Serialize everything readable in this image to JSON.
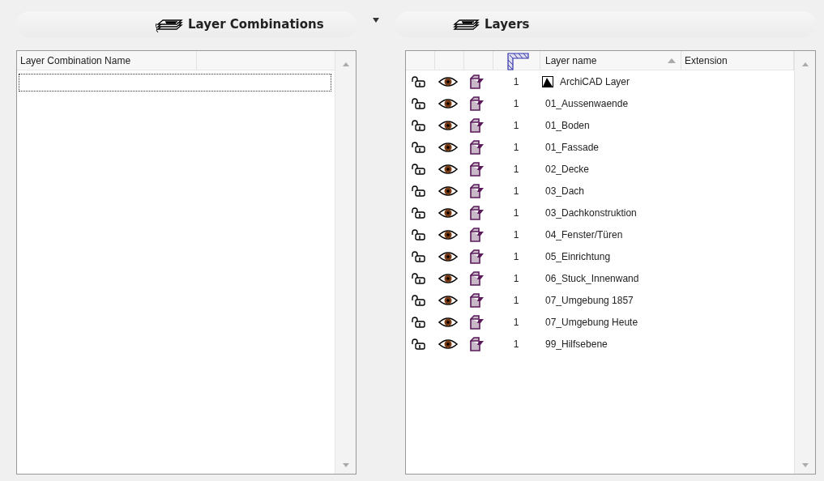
{
  "combinations_panel": {
    "title": "Layer Combinations",
    "columns": [
      "Layer Combination Name"
    ],
    "rows": [
      {
        "name": "",
        "selected": true
      }
    ]
  },
  "layers_panel": {
    "title": "Layers",
    "columns": [
      "Layer name",
      "Extension"
    ],
    "rows": [
      {
        "kind": "archicad",
        "locked": false,
        "visible": true,
        "intersection": "1",
        "name": "ArchiCAD Layer"
      },
      {
        "kind": "user",
        "locked": false,
        "visible": true,
        "intersection": "1",
        "name": "01_Aussenwaende"
      },
      {
        "kind": "user",
        "locked": false,
        "visible": true,
        "intersection": "1",
        "name": "01_Boden"
      },
      {
        "kind": "user",
        "locked": false,
        "visible": true,
        "intersection": "1",
        "name": "01_Fassade"
      },
      {
        "kind": "user",
        "locked": false,
        "visible": true,
        "intersection": "1",
        "name": "02_Decke"
      },
      {
        "kind": "user",
        "locked": false,
        "visible": true,
        "intersection": "1",
        "name": "03_Dach"
      },
      {
        "kind": "user",
        "locked": false,
        "visible": true,
        "intersection": "1",
        "name": "03_Dachkonstruktion"
      },
      {
        "kind": "user",
        "locked": false,
        "visible": true,
        "intersection": "1",
        "name": "04_Fenster/Türen"
      },
      {
        "kind": "user",
        "locked": false,
        "visible": true,
        "intersection": "1",
        "name": "05_Einrichtung"
      },
      {
        "kind": "user",
        "locked": false,
        "visible": true,
        "intersection": "1",
        "name": "06_Stuck_Innenwand"
      },
      {
        "kind": "user",
        "locked": false,
        "visible": true,
        "intersection": "1",
        "name": "07_Umgebung 1857"
      },
      {
        "kind": "user",
        "locked": false,
        "visible": true,
        "intersection": "1",
        "name": "07_Umgebung Heute"
      },
      {
        "kind": "user",
        "locked": false,
        "visible": true,
        "intersection": "1",
        "name": "99_Hilfsebene"
      }
    ]
  }
}
